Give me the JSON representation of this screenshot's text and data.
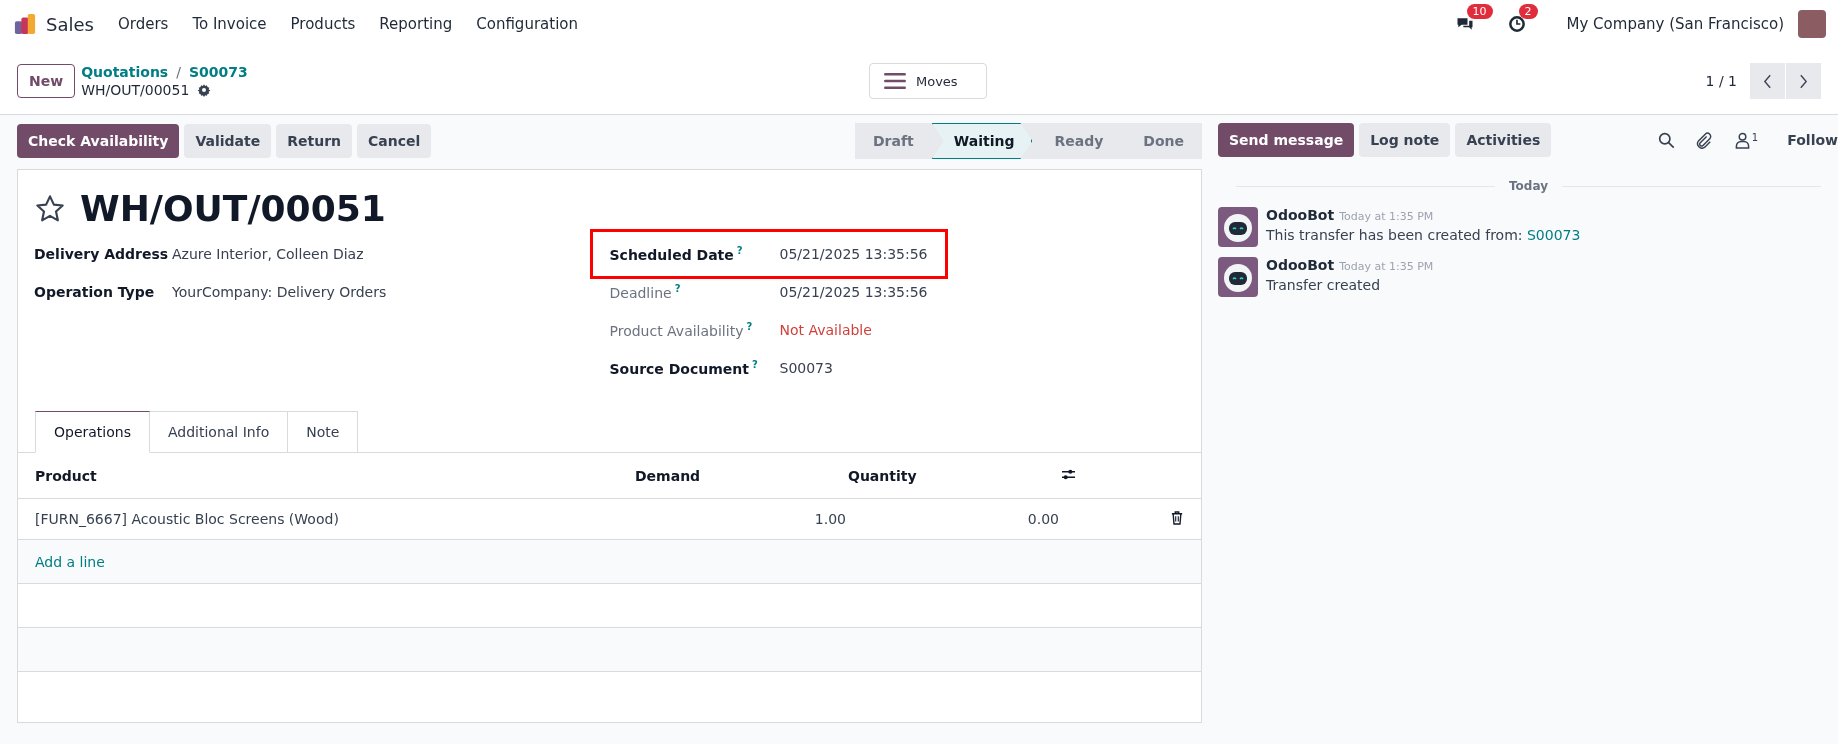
{
  "navbar": {
    "app_name": "Sales",
    "menu": [
      "Orders",
      "To Invoice",
      "Products",
      "Reporting",
      "Configuration"
    ],
    "messages_count": "10",
    "activities_count": "2",
    "company": "My Company (San Francisco)"
  },
  "control_panel": {
    "new_button": "New",
    "breadcrumbs": [
      "Quotations",
      "S00073"
    ],
    "breadcrumb_separator": "/",
    "record_name": "WH/OUT/00051",
    "moves_button": "Moves",
    "pager": "1 / 1"
  },
  "action_buttons": [
    {
      "label": "Check Availability",
      "primary": true
    },
    {
      "label": "Validate",
      "primary": false
    },
    {
      "label": "Return",
      "primary": false
    },
    {
      "label": "Cancel",
      "primary": false
    }
  ],
  "status_steps": [
    {
      "label": "Draft",
      "selected": false
    },
    {
      "label": "Waiting",
      "selected": true
    },
    {
      "label": "Ready",
      "selected": false
    },
    {
      "label": "Done",
      "selected": false
    }
  ],
  "form": {
    "title": "WH/OUT/00051",
    "starred": false,
    "left_fields": [
      {
        "label": "Delivery Address",
        "value": "Azure Interior, Colleen Diaz",
        "required": true,
        "highlighted": false,
        "alert": false
      },
      {
        "label": "Operation Type",
        "value": "YourCompany: Delivery Orders",
        "required": true,
        "highlighted": false,
        "alert": false
      }
    ],
    "right_fields": [
      {
        "label": "Scheduled Date",
        "value": "05/21/2025 13:35:56",
        "help": "?",
        "required": true,
        "highlighted": true,
        "alert": false
      },
      {
        "label": "Deadline",
        "value": "05/21/2025 13:35:56",
        "help": "?",
        "required": false,
        "highlighted": false,
        "alert": false
      },
      {
        "label": "Product Availability",
        "value": "Not Available",
        "help": "?",
        "required": false,
        "highlighted": false,
        "alert": true
      },
      {
        "label": "Source Document",
        "value": "S00073",
        "help": "?",
        "required": true,
        "highlighted": false,
        "alert": false
      }
    ],
    "tabs": [
      {
        "label": "Operations",
        "selected": true
      },
      {
        "label": "Additional Info",
        "selected": false
      },
      {
        "label": "Note",
        "selected": false
      }
    ],
    "table": {
      "columns": [
        "Product",
        "Demand",
        "Quantity"
      ],
      "rows": [
        {
          "product": "[FURN_6667] Acoustic Bloc Screens (Wood)",
          "demand": "1.00",
          "quantity": "0.00"
        }
      ],
      "add_line": "Add a line"
    }
  },
  "chatter": {
    "buttons": [
      {
        "label": "Send message",
        "primary": true
      },
      {
        "label": "Log note",
        "primary": false
      },
      {
        "label": "Activities",
        "primary": false
      }
    ],
    "followers_count": "1",
    "follow": "Follow",
    "day": "Today",
    "messages": [
      {
        "author": "OdooBot",
        "time": "Today at 1:35 PM",
        "text": "This transfer has been created from: ",
        "link": "S00073"
      },
      {
        "author": "OdooBot",
        "time": "Today at 1:35 PM",
        "text": "Transfer created"
      }
    ]
  }
}
